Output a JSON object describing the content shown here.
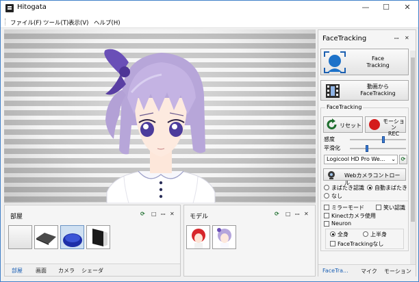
{
  "window": {
    "title": "Hitogata",
    "controls": {
      "minimize": "—",
      "maximize": "☐",
      "close": "✕"
    }
  },
  "menu": [
    "ファイル(F)",
    "ツール(T)",
    "表示(V)",
    "ヘルプ(H)"
  ],
  "room_panel": {
    "title": "部屋",
    "thumbnails": [
      "room-plain",
      "room-carpet",
      "room-blue",
      "room-dark"
    ],
    "tabs": [
      "部屋",
      "画面",
      "カメラ",
      "シェーダ"
    ]
  },
  "model_panel": {
    "title": "モデル",
    "thumbnails": [
      "model-red-hair",
      "model-purple-hair"
    ]
  },
  "panel_icons": {
    "refresh": "⟳",
    "maximize": "□",
    "pin": "ꟷ",
    "close": "✕"
  },
  "face_panel": {
    "title": "FaceTracking",
    "pin": "ꟷ",
    "close": "✕",
    "face_button_label": "Face\nTracking",
    "video_button_label": "動画から\nFaceTracking",
    "group_title": "FaceTracking",
    "reset_label": "リセット",
    "rec_label": "モーション\nREC",
    "sensitivity_label": "感度",
    "sensitivity_value": 0.6,
    "smoothing_label": "平滑化",
    "smoothing_value": 0.3,
    "camera_select": "Logicool HD Pro We...",
    "webcam_button": "Webカメラコントロール",
    "blink_options": [
      "まばたき認識",
      "自動まばたき",
      "なし"
    ],
    "blink_selected": 1,
    "checks": [
      {
        "label": "ミラーモード",
        "checked": false
      },
      {
        "label": "笑い認識",
        "checked": false
      },
      {
        "label": "Kinectカメラ使用",
        "checked": false
      },
      {
        "label": "Neuron",
        "checked": false
      }
    ],
    "body_options": [
      "全身",
      "上半身"
    ],
    "body_selected": 0,
    "no_tracking_label": "FaceTrackingなし",
    "tabs": [
      "FaceTra...",
      "マイク",
      "モーション"
    ]
  }
}
